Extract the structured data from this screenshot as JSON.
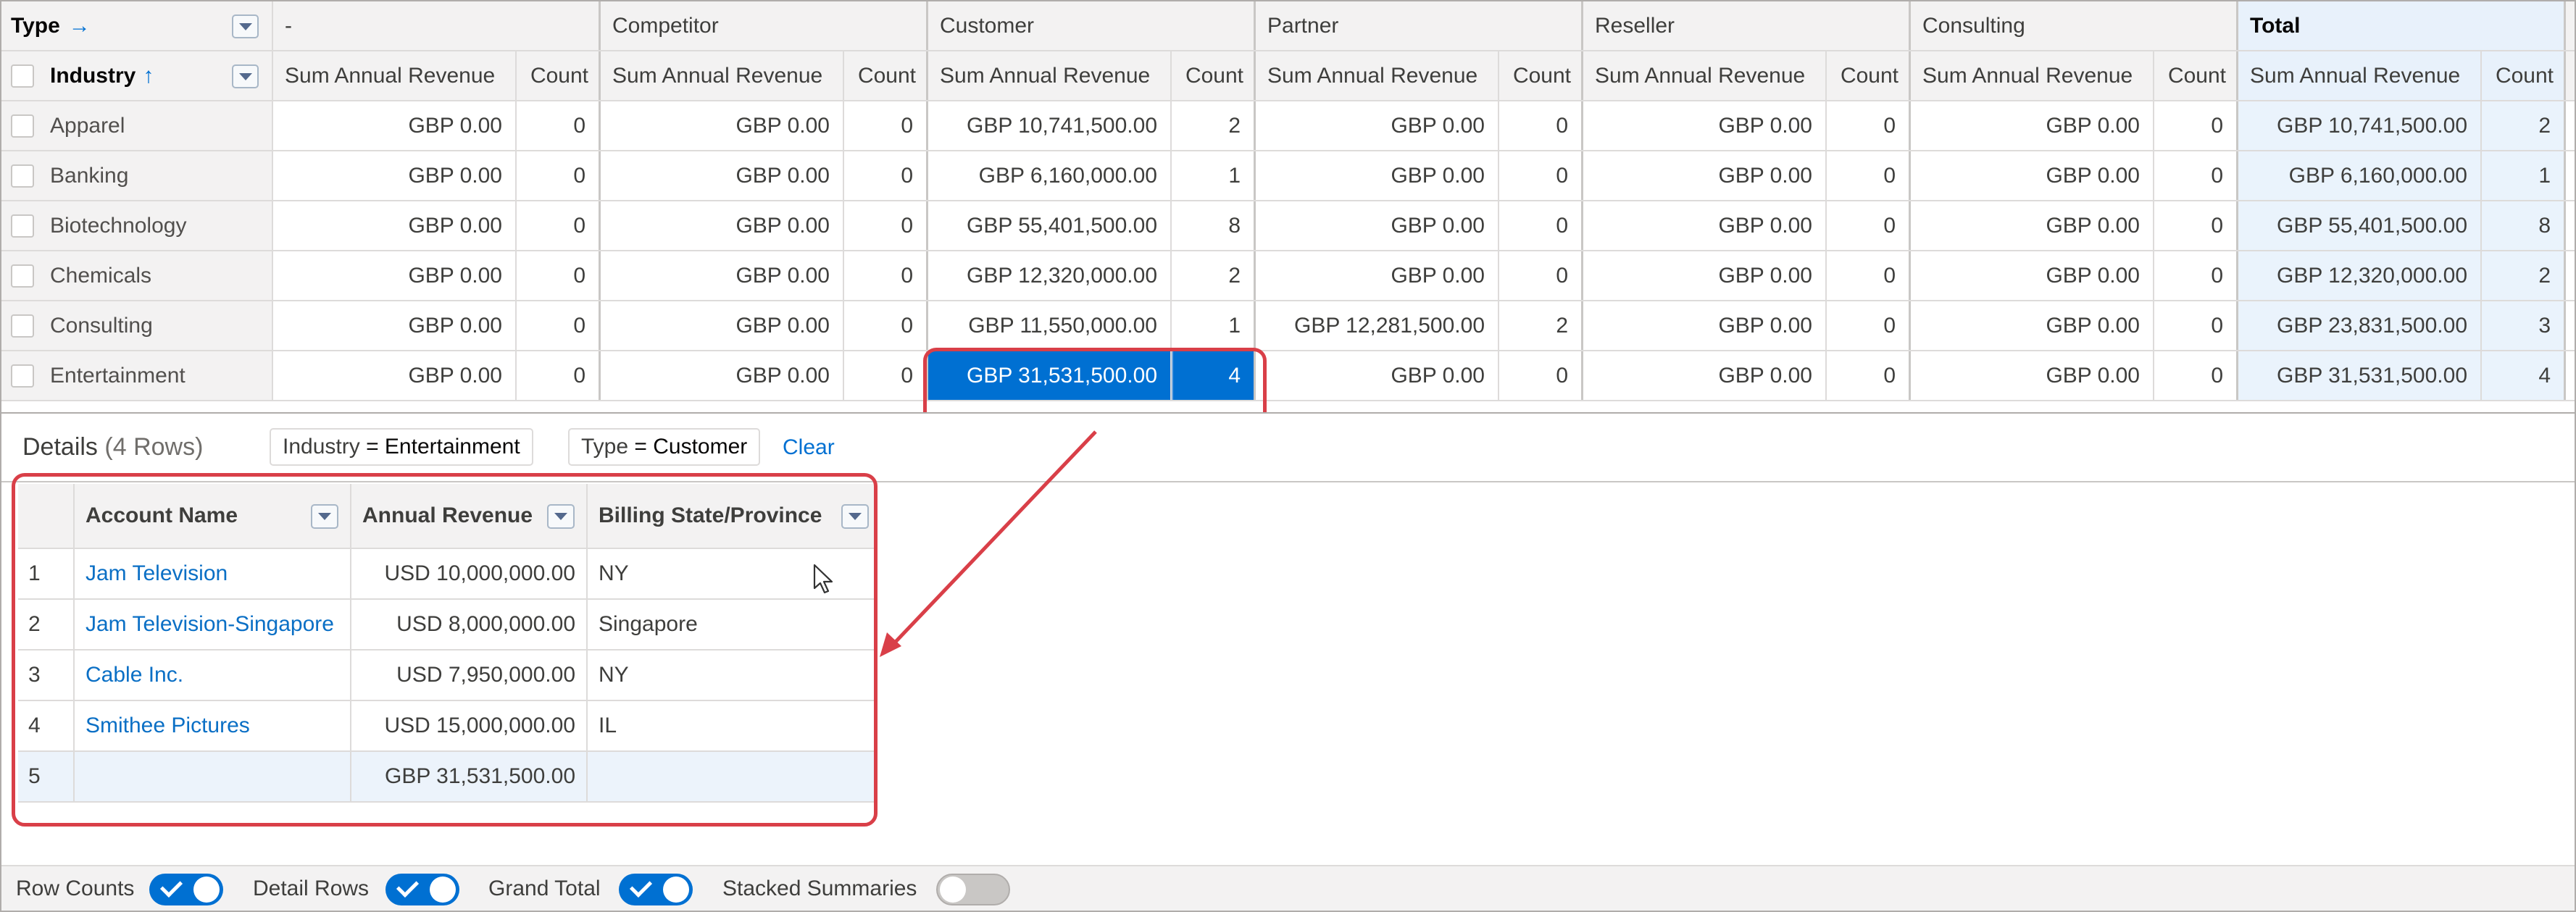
{
  "matrix": {
    "type_label": "Type",
    "type_arrow": "→",
    "industry_label": "Industry",
    "industry_arrow": "↑",
    "groups": [
      "-",
      "Competitor",
      "Customer",
      "Partner",
      "Reseller",
      "Consulting",
      "Total"
    ],
    "sum_label": "Sum Annual Revenue",
    "count_label": "Count",
    "rows": [
      {
        "industry": "Apparel",
        "cells": [
          [
            "GBP 0.00",
            "0"
          ],
          [
            "GBP 0.00",
            "0"
          ],
          [
            "GBP 10,741,500.00",
            "2"
          ],
          [
            "GBP 0.00",
            "0"
          ],
          [
            "GBP 0.00",
            "0"
          ],
          [
            "GBP 0.00",
            "0"
          ],
          [
            "GBP 10,741,500.00",
            "2"
          ]
        ]
      },
      {
        "industry": "Banking",
        "cells": [
          [
            "GBP 0.00",
            "0"
          ],
          [
            "GBP 0.00",
            "0"
          ],
          [
            "GBP 6,160,000.00",
            "1"
          ],
          [
            "GBP 0.00",
            "0"
          ],
          [
            "GBP 0.00",
            "0"
          ],
          [
            "GBP 0.00",
            "0"
          ],
          [
            "GBP 6,160,000.00",
            "1"
          ]
        ]
      },
      {
        "industry": "Biotechnology",
        "cells": [
          [
            "GBP 0.00",
            "0"
          ],
          [
            "GBP 0.00",
            "0"
          ],
          [
            "GBP 55,401,500.00",
            "8"
          ],
          [
            "GBP 0.00",
            "0"
          ],
          [
            "GBP 0.00",
            "0"
          ],
          [
            "GBP 0.00",
            "0"
          ],
          [
            "GBP 55,401,500.00",
            "8"
          ]
        ]
      },
      {
        "industry": "Chemicals",
        "cells": [
          [
            "GBP 0.00",
            "0"
          ],
          [
            "GBP 0.00",
            "0"
          ],
          [
            "GBP 12,320,000.00",
            "2"
          ],
          [
            "GBP 0.00",
            "0"
          ],
          [
            "GBP 0.00",
            "0"
          ],
          [
            "GBP 0.00",
            "0"
          ],
          [
            "GBP 12,320,000.00",
            "2"
          ]
        ]
      },
      {
        "industry": "Consulting",
        "cells": [
          [
            "GBP 0.00",
            "0"
          ],
          [
            "GBP 0.00",
            "0"
          ],
          [
            "GBP 11,550,000.00",
            "1"
          ],
          [
            "GBP 12,281,500.00",
            "2"
          ],
          [
            "GBP 0.00",
            "0"
          ],
          [
            "GBP 0.00",
            "0"
          ],
          [
            "GBP 23,831,500.00",
            "3"
          ]
        ]
      },
      {
        "industry": "Entertainment",
        "cells": [
          [
            "GBP 0.00",
            "0"
          ],
          [
            "GBP 0.00",
            "0"
          ],
          [
            "GBP 31,531,500.00",
            "4"
          ],
          [
            "GBP 0.00",
            "0"
          ],
          [
            "GBP 0.00",
            "0"
          ],
          [
            "GBP 0.00",
            "0"
          ],
          [
            "GBP 31,531,500.00",
            "4"
          ]
        ]
      }
    ],
    "selected": {
      "row": 5,
      "group": 2
    }
  },
  "details": {
    "title": "Details",
    "rows_label": "(4 Rows)",
    "filter_industry_key": "Industry",
    "filter_industry_value": "= Entertainment",
    "filter_type_key": "Type",
    "filter_type_value": "= Customer",
    "clear_label": "Clear",
    "columns": [
      "Account Name",
      "Annual Revenue",
      "Billing State/Province"
    ],
    "rows": [
      {
        "num": "1",
        "name": "Jam Television",
        "revenue": "USD 10,000,000.00",
        "state": "NY"
      },
      {
        "num": "2",
        "name": "Jam Television-Singapore",
        "revenue": "USD 8,000,000.00",
        "state": "Singapore"
      },
      {
        "num": "3",
        "name": "Cable Inc.",
        "revenue": "USD 7,950,000.00",
        "state": "NY"
      },
      {
        "num": "4",
        "name": "Smithee Pictures",
        "revenue": "USD 15,000,000.00",
        "state": "IL"
      }
    ],
    "summary": {
      "num": "5",
      "revenue": "GBP 31,531,500.00"
    }
  },
  "footer": {
    "toggles": [
      {
        "label": "Row Counts",
        "on": true
      },
      {
        "label": "Detail Rows",
        "on": true
      },
      {
        "label": "Grand Total",
        "on": true
      },
      {
        "label": "Stacked Summaries",
        "on": false
      }
    ]
  },
  "colors": {
    "accent": "#0070d2",
    "callout": "#d93f48",
    "link": "#0a6fc5"
  }
}
